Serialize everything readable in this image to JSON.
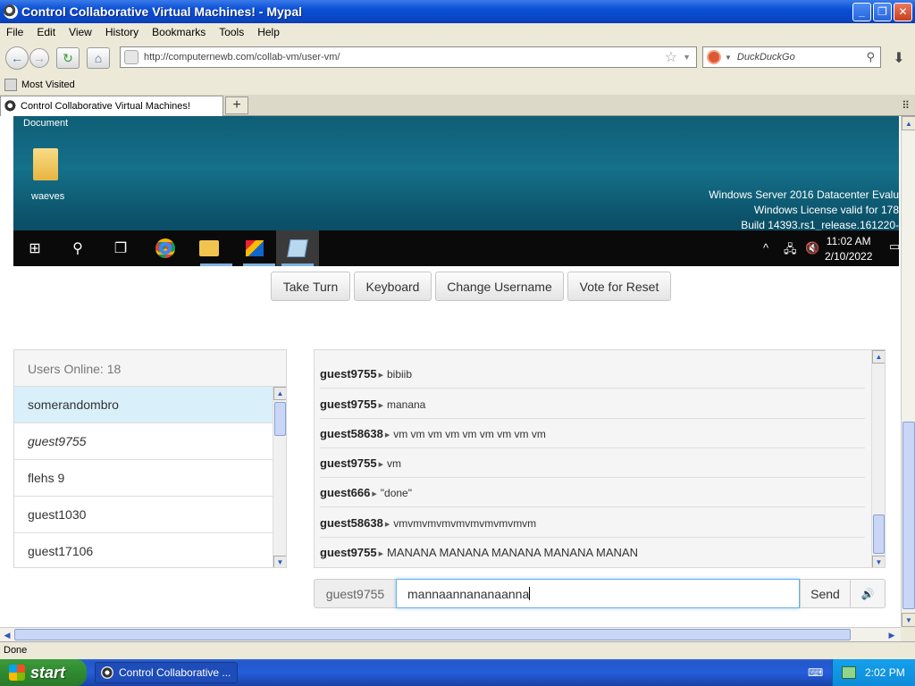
{
  "window": {
    "title": "Control Collaborative Virtual Machines! - Mypal",
    "buttons": {
      "minimize": "_",
      "maximize": "❐",
      "close": "✕"
    }
  },
  "menu": [
    "File",
    "Edit",
    "View",
    "History",
    "Bookmarks",
    "Tools",
    "Help"
  ],
  "nav": {
    "url": "http://computernewb.com/collab-vm/user-vm/",
    "search_placeholder": "DuckDuckGo"
  },
  "bookmarks": {
    "most_visited": "Most Visited"
  },
  "tabs": [
    {
      "label": "Control Collaborative Virtual Machines!"
    }
  ],
  "vm": {
    "doc_label": "Document",
    "folder_label": "waeves",
    "watermark": [
      "Windows Server 2016 Datacenter Evalu",
      "Windows License valid for 178",
      "Build 14393.rs1_release.161220-"
    ],
    "clock_time": "11:02 AM",
    "clock_date": "2/10/2022"
  },
  "actions": {
    "take_turn": "Take Turn",
    "keyboard": "Keyboard",
    "change_username": "Change Username",
    "vote_reset": "Vote for Reset"
  },
  "users": {
    "header": "Users Online: 18",
    "list": [
      "somerandombro",
      "guest9755",
      "flehs 9",
      "guest1030",
      "guest17106"
    ]
  },
  "chat": {
    "messages": [
      {
        "user": "guest9755",
        "text": "bibiib"
      },
      {
        "user": "guest9755",
        "text": "manana"
      },
      {
        "user": "guest58638",
        "text": "vm vm vm vm vm vm vm vm vm"
      },
      {
        "user": "guest9755",
        "text": "vm"
      },
      {
        "user": "guest666",
        "text": "\"done\""
      },
      {
        "user": "guest58638",
        "text": "vmvmvmvmvmvmvmvmvmvm"
      },
      {
        "user": "guest9755",
        "text": "MANANA MANANA MANANA MANANA MANAN"
      }
    ],
    "username": "guest9755",
    "input_value": "mannaannananaanna",
    "send_label": "Send"
  },
  "status": {
    "text": "Done"
  },
  "taskbar": {
    "start_label": "start",
    "task_item": "Control Collaborative ...",
    "time": "2:02 PM"
  }
}
